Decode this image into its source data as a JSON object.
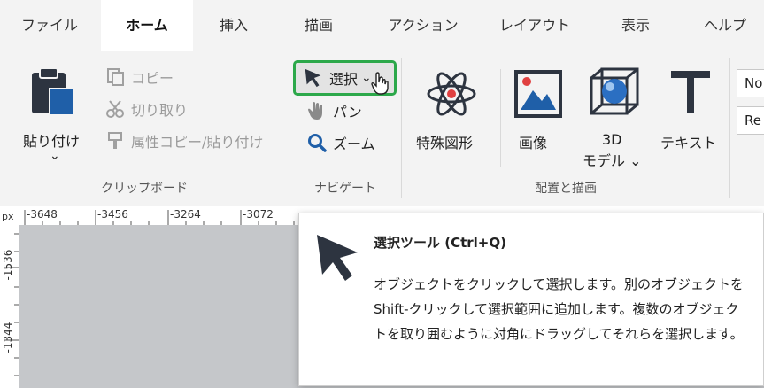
{
  "tabs": [
    "ファイル",
    "ホーム",
    "挿入",
    "描画",
    "アクション",
    "レイアウト",
    "表示",
    "ヘルプ"
  ],
  "clipboard": {
    "paste": "貼り付け",
    "paste_arrow": "⌄",
    "copy": "コピー",
    "cut": "切り取り",
    "format_copy": "属性コピー/貼り付け",
    "group": "クリップボード"
  },
  "navigation": {
    "select": "選択",
    "pan": "パン",
    "zoom": "ズーム",
    "group": "ナビゲート"
  },
  "insert_group": {
    "special_shapes": "特殊図形",
    "image": "画像",
    "model_3d_line1": "3D",
    "model_3d_line2": "モデル ⌄",
    "text": "テキスト",
    "group": "配置と描画"
  },
  "fields": {
    "field1": "No",
    "field2": "Re"
  },
  "ruler": {
    "unit": "px",
    "h_ticks": [
      "-3648",
      "-3456",
      "-3264",
      "-3072"
    ],
    "v_ticks": [
      "-1536",
      "-1344"
    ]
  },
  "tooltip": {
    "title": "選択ツール (Ctrl+Q)",
    "body": "オブジェクトをクリックして選択します。別のオブジェクトを Shift-クリックして選択範囲に追加します。複数のオブジェクトを取り囲むように対角にドラッグしてそれらを選択します。"
  },
  "colors": {
    "highlight": "#2ca84a",
    "accent_blue": "#1f5fa8"
  }
}
